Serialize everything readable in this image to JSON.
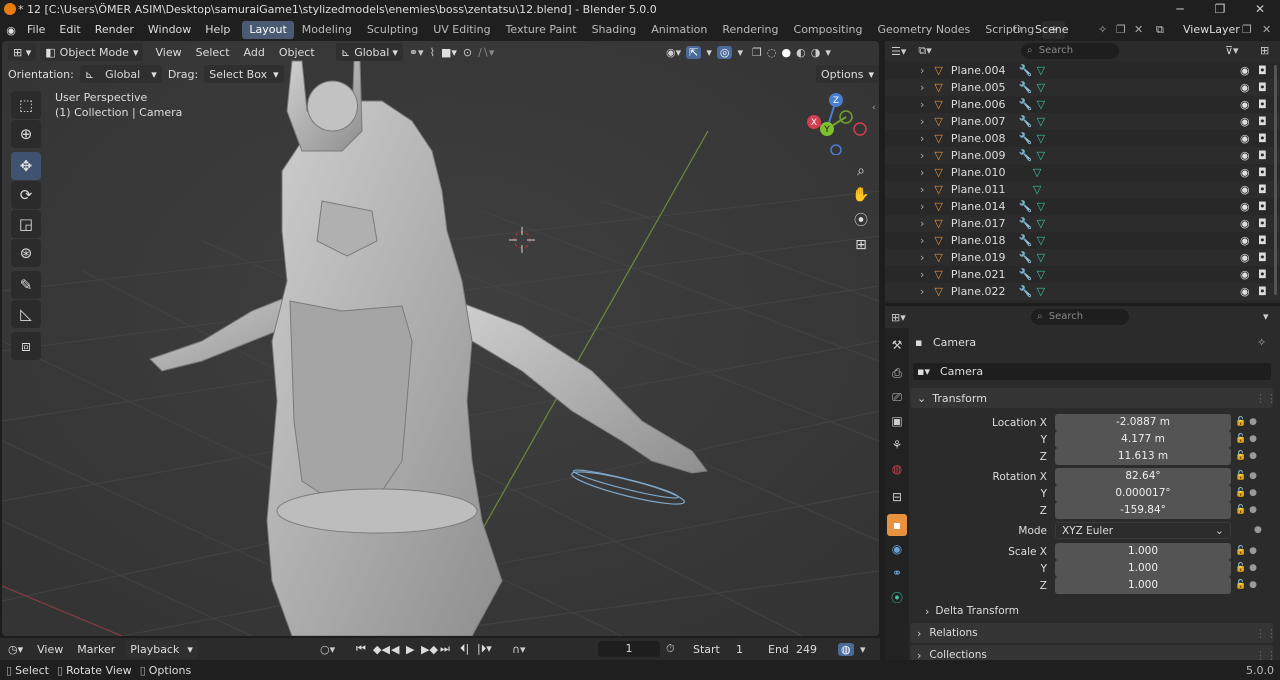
{
  "window": {
    "title": "* 12 [C:\\Users\\ÖMER ASIM\\Desktop\\samuraiGame1\\stylizedmodels\\enemies\\boss\\zentatsu\\12.blend] - Blender 5.0.0",
    "minimize": "─",
    "maximize": "❐",
    "close": "✕"
  },
  "menubar": {
    "items": [
      "File",
      "Edit",
      "Render",
      "Window",
      "Help"
    ],
    "workspaces": [
      "Layout",
      "Modeling",
      "Sculpting",
      "UV Editing",
      "Texture Paint",
      "Shading",
      "Animation",
      "Rendering",
      "Compositing",
      "Geometry Nodes",
      "Scripting"
    ],
    "active_workspace": "Layout",
    "add_workspace": "+",
    "scene_label": "Scene",
    "viewlayer_label": "ViewLayer"
  },
  "viewport_header": {
    "mode": "Object Mode",
    "menus": [
      "View",
      "Select",
      "Add",
      "Object"
    ],
    "transform_orientation": "Global",
    "orientation_label": "Orientation:",
    "orientation_value": "Global",
    "drag_label": "Drag:",
    "drag_value": "Select Box",
    "options_label": "Options"
  },
  "viewport": {
    "perspective": "User Perspective",
    "collection_info": "(1) Collection | Camera",
    "gizmo": {
      "z": "Z",
      "y": "Y",
      "x": "X"
    }
  },
  "outliner": {
    "search_placeholder": "Search",
    "items": [
      "Plane.004",
      "Plane.005",
      "Plane.006",
      "Plane.007",
      "Plane.008",
      "Plane.009",
      "Plane.010",
      "Plane.011",
      "Plane.014",
      "Plane.017",
      "Plane.018",
      "Plane.019",
      "Plane.021",
      "Plane.022"
    ]
  },
  "properties": {
    "search_placeholder": "Search",
    "object_name": "Camera",
    "data_name": "Camera",
    "transform_header": "Transform",
    "location_label": "Location X",
    "location": {
      "x": "-2.0887 m",
      "y": "4.177 m",
      "z": "11.613 m"
    },
    "rotation_label": "Rotation X",
    "rotation": {
      "x": "82.64°",
      "y": "0.000017°",
      "z": "-159.84°"
    },
    "mode_label": "Mode",
    "mode_value": "XYZ Euler",
    "scale_label": "Scale X",
    "scale": {
      "x": "1.000",
      "y": "1.000",
      "z": "1.000"
    },
    "axis_y": "Y",
    "axis_z": "Z",
    "delta_transform": "Delta Transform",
    "relations": "Relations",
    "collections": "Collections"
  },
  "timeline": {
    "menus": [
      "View",
      "Marker",
      "Playback"
    ],
    "current_frame": "1",
    "start_label": "Start",
    "start_value": "1",
    "end_label": "End",
    "end_value": "249"
  },
  "statusbar": {
    "select": "Select",
    "rotate_view": "Rotate View",
    "options": "Options",
    "version": "5.0.0"
  }
}
